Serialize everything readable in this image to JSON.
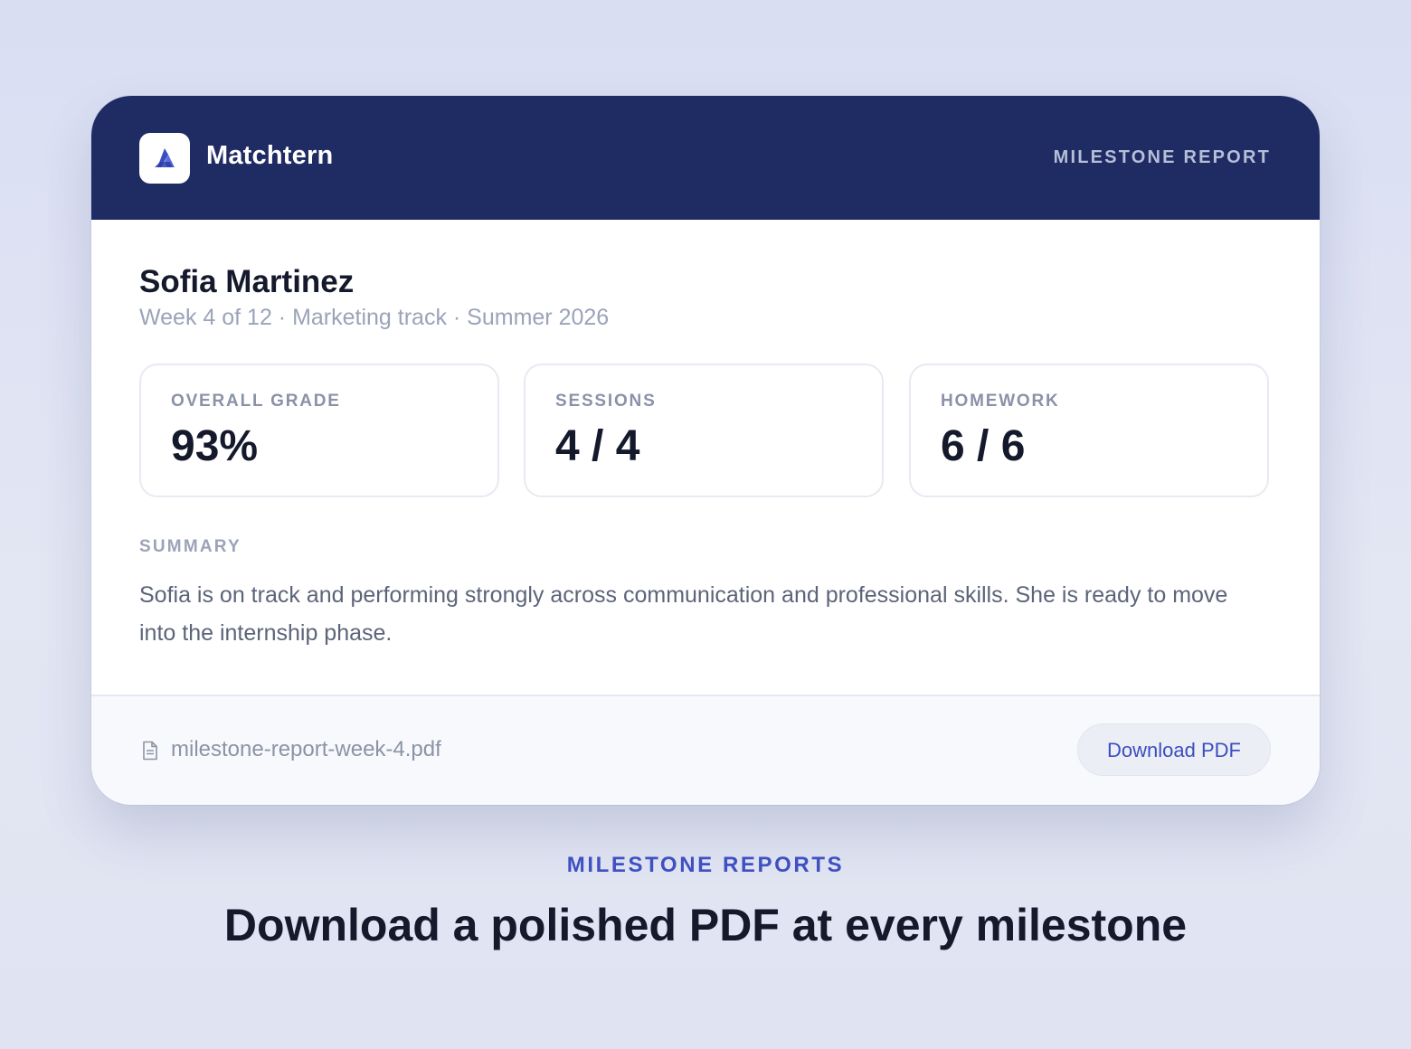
{
  "header": {
    "brand_name": "Matchtern",
    "tag": "MILESTONE REPORT",
    "logo_icon": "triangle-logo-icon",
    "brand_color": "#1f2b63",
    "accent_color": "#3a4ec0"
  },
  "student": {
    "name": "Sofia Martinez",
    "meta": "Week 4 of 12 · Marketing track · Summer 2026"
  },
  "stats": [
    {
      "label": "OVERALL GRADE",
      "value": "93%"
    },
    {
      "label": "SESSIONS",
      "value": "4 / 4"
    },
    {
      "label": "HOMEWORK",
      "value": "6 / 6"
    }
  ],
  "summary": {
    "label": "SUMMARY",
    "text": "Sofia is on track and performing strongly across communication and professional skills. She is ready to move into the internship phase."
  },
  "footer": {
    "file_icon": "document-icon",
    "file_name": "milestone-report-week-4.pdf",
    "download_label": "Download PDF"
  },
  "promo": {
    "eyebrow": "MILESTONE REPORTS",
    "headline": "Download a polished PDF at every milestone"
  }
}
